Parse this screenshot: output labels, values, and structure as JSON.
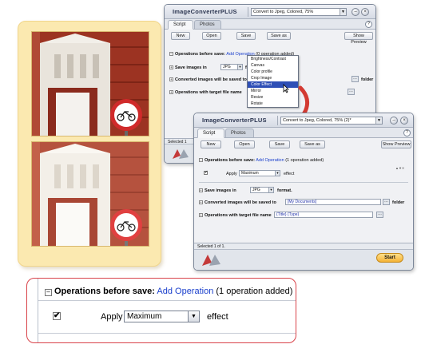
{
  "window_a": {
    "app_name": "ImageConverterPLUS",
    "preset": "Convert to Jpeg, Colored, 75%",
    "tabs": [
      "Script",
      "Photos"
    ],
    "toolbar": {
      "new": "New",
      "open": "Open",
      "save": "Save",
      "save_as": "Save as",
      "show_preview": "Show Preview"
    },
    "ops_label": "Operations before save:",
    "add_operation": "Add Operation",
    "ops_count": "(0 operation added)",
    "save_images_label": "Save images in",
    "format_value": "JPG",
    "format_suffix": "format",
    "converted_label": "Converted images will be saved to",
    "folder_suffix": "folder",
    "target_label": "Operations with target file name",
    "status": "Selected 1",
    "context_menu": [
      "Brightness/Contrast",
      "Canvas",
      "Color profile",
      "Crop Image",
      "Color Effect",
      "Mirror",
      "Resize",
      "Rotate"
    ],
    "context_selected_index": 4
  },
  "window_b": {
    "app_name": "ImageConverterPLUS",
    "preset": "Convert to Jpeg, Colored, 75% (2)*",
    "tabs": [
      "Script",
      "Photos"
    ],
    "toolbar": {
      "new": "New",
      "open": "Open",
      "save": "Save",
      "save_as": "Save as",
      "show_preview": "Show Preview"
    },
    "ops_label": "Operations before save:",
    "add_operation": "Add Operation",
    "ops_count": "(1 operation added)",
    "apply_label": "Apply",
    "effect_value": "Maximum",
    "effect_suffix": "effect",
    "save_images_label": "Save images in",
    "format_value": "JPG",
    "format_suffix": "format.",
    "converted_label": "Converted images will be saved to",
    "folder_value": "[My Documents]",
    "folder_suffix": "folder",
    "target_label": "Operations with target file name",
    "target_value": "{Title} {Type}",
    "status": "Selected 1 of 1.",
    "start": "Start"
  },
  "zoom": {
    "ops_label": "Operations before save:",
    "add_operation": "Add Operation",
    "ops_count": "(1 operation added)",
    "apply_label": "Apply",
    "effect_value": "Maximum",
    "effect_suffix": "effect",
    "checkbox_checked": true
  },
  "colors": {
    "accent_link": "#1a3fcc",
    "highlight_red": "#d9434a",
    "card_bg": "#fbe9b0",
    "menu_selected": "#2e4fb6",
    "start_button": "#f4b236"
  }
}
